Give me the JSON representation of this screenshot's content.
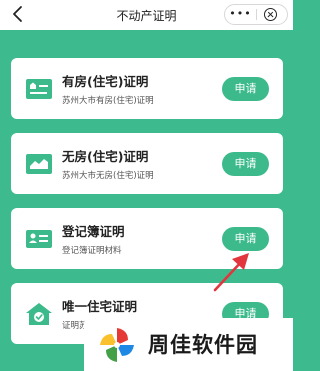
{
  "header": {
    "title": "不动产证明",
    "back_icon": "chevron-left-icon",
    "more_icon": "ellipsis-icon",
    "more_glyph": "•••",
    "close_icon": "circle-close-icon"
  },
  "colors": {
    "background": "#3dbb8e",
    "accent": "#3cba8c",
    "arrow": "#e2353e"
  },
  "cards": [
    {
      "title": "有房(住宅)证明",
      "subtitle": "苏州大市有房(住宅)证明",
      "button": "申请",
      "icon": "house-certificate-icon"
    },
    {
      "title": "无房(住宅)证明",
      "subtitle": "苏州大市无房(住宅)证明",
      "button": "申请",
      "icon": "no-house-certificate-icon"
    },
    {
      "title": "登记簿证明",
      "subtitle": "登记簿证明材料",
      "button": "申请",
      "icon": "id-card-icon"
    },
    {
      "title": "唯一住宅证明",
      "subtitle": "证明苏州大市有且一套住宅",
      "button": "申请",
      "icon": "house-check-icon"
    }
  ],
  "watermark": {
    "text": "周佳软件园",
    "logo_icon": "pinwheel-logo-icon"
  }
}
